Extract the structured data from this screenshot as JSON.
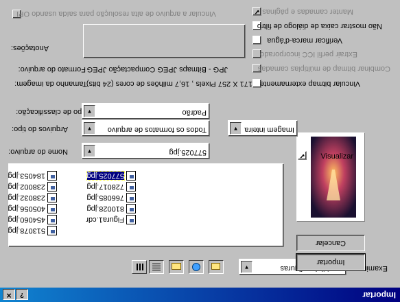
{
  "window": {
    "title": "Importar",
    "help_label": "?",
    "close_label": "✕"
  },
  "examinar": {
    "label": "Examinar:",
    "value": "Minhas figuras"
  },
  "buttons": {
    "importar": "Importar",
    "cancelar": "Cancelar"
  },
  "preview": {
    "label": "Visualizar",
    "checked": true
  },
  "files": [
    {
      "name": "184053.jpg",
      "col": 0,
      "row": 0,
      "selected": false
    },
    {
      "name": "238002.jpg",
      "col": 0,
      "row": 1,
      "selected": false
    },
    {
      "name": "238032.jpg",
      "col": 0,
      "row": 2,
      "selected": false
    },
    {
      "name": "405056.jpg",
      "col": 0,
      "row": 3,
      "selected": false
    },
    {
      "name": "454060.jpg",
      "col": 0,
      "row": 4,
      "selected": false
    },
    {
      "name": "513078.jpg",
      "col": 0,
      "row": 5,
      "selected": false
    },
    {
      "name": "577025.jpg",
      "col": 1,
      "row": 0,
      "selected": true
    },
    {
      "name": "728017.jpg",
      "col": 1,
      "row": 1,
      "selected": false
    },
    {
      "name": "766085.jpg",
      "col": 1,
      "row": 2,
      "selected": false
    },
    {
      "name": "810028.jpg",
      "col": 1,
      "row": 3,
      "selected": false
    },
    {
      "name": "Figura1.cdr",
      "col": 1,
      "row": 4,
      "selected": false
    }
  ],
  "fields": {
    "nome": {
      "label": "Nome do arquivo:",
      "value": "577025.jpg"
    },
    "tipo": {
      "label": "Arquivos do tipo:",
      "value": "Todos os formatos de arquivo"
    },
    "imagem": {
      "value": "Imagem inteira"
    },
    "classificacao": {
      "label": "Tipo de classificação:",
      "value": "Padrão"
    }
  },
  "info": {
    "tamanho_label": "Tamanho da imagem:",
    "tamanho_value": "171 X 257 Pixels , 16,7 milhões de cores (24 bits)",
    "formato_label": "Formato do arquivo:",
    "formato_value": "JPG - Bitmaps JPEG Compactação JPEG",
    "anotacoes_label": "Anotações:"
  },
  "options": [
    {
      "label": "Vincular bitmap externamente",
      "enabled": true,
      "checked": false
    },
    {
      "label": "Combinar bitmap de múltiplas camadas",
      "enabled": false,
      "checked": false
    },
    {
      "label": "Extrair perfil ICC incorporado",
      "enabled": false,
      "checked": false
    },
    {
      "label": "Verificar marca-d'água",
      "enabled": true,
      "checked": false
    },
    {
      "label": "Não mostrar caixa de diálogo de filtro",
      "enabled": true,
      "checked": false
    },
    {
      "label": "Manter camadas e páginas",
      "enabled": false,
      "checked": true
    }
  ],
  "vincular_alta": {
    "label": "Vincular a arquivo de alta resolução para saída usando OPI",
    "enabled": false
  },
  "colors": {
    "titlebar": "#000080",
    "face": "#c0c0c0",
    "selection": "#000080"
  }
}
